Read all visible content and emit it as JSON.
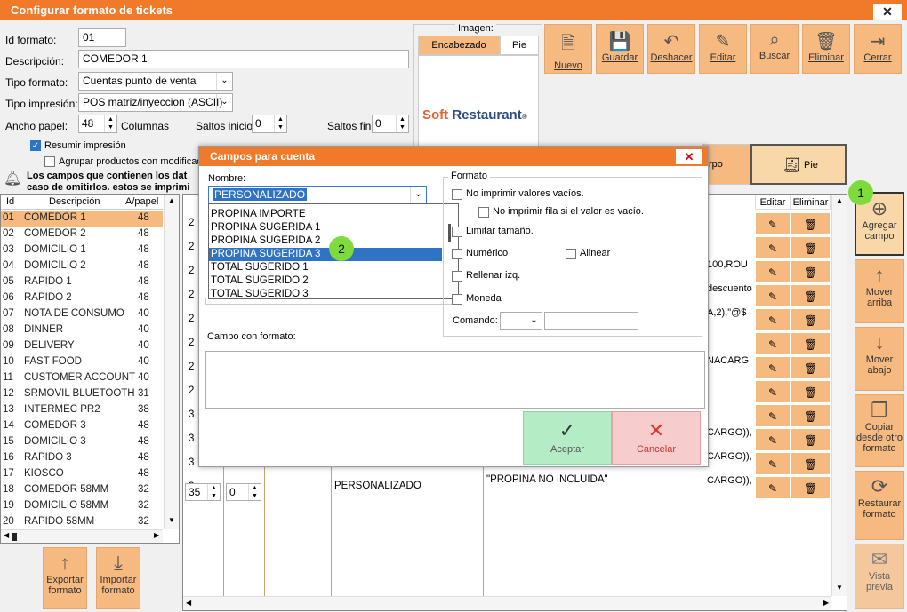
{
  "window": {
    "title": "Configurar formato de tickets",
    "close": "✕"
  },
  "form": {
    "id_label": "Id formato:",
    "id_value": "01",
    "desc_label": "Descripción:",
    "desc_value": "COMEDOR 1",
    "tipo_formato_label": "Tipo formato:",
    "tipo_formato_value": "Cuentas punto de venta",
    "tipo_impresion_label": "Tipo impresión:",
    "tipo_impresion_value": "POS matriz/inyeccion (ASCII)",
    "ancho_label": "Ancho papel:",
    "ancho_value": "48",
    "columnas_label": "Columnas",
    "saltos_inicio_label": "Saltos inicio:",
    "saltos_inicio_value": "0",
    "saltos_fin_label": "Saltos fin:",
    "saltos_fin_value": "0",
    "resumir_label": "Resumir impresión",
    "agrupar_label": "Agrupar productos con modificad",
    "notice_line1": "Los campos que contienen los dat",
    "notice_line2": "caso de omitirlos. estos se imprimi"
  },
  "image_panel": {
    "label": "Imagen:",
    "tab_header": "Encabezado",
    "tab_footer": "Pie",
    "logo_soft": "Soft",
    "logo_restaurant": "Restaurant",
    "logo_reg": "®"
  },
  "toolbar": [
    {
      "label": "Nuevo",
      "icon": "new-icon"
    },
    {
      "label": "Guardar",
      "icon": "save-icon"
    },
    {
      "label": "Deshacer",
      "icon": "undo-icon"
    },
    {
      "label": "Editar",
      "icon": "edit-icon"
    },
    {
      "label": "Buscar",
      "icon": "search-icon"
    },
    {
      "label": "Eliminar",
      "icon": "delete-icon"
    },
    {
      "label": "Cerrar",
      "icon": "exit-icon"
    }
  ],
  "section_tabs": {
    "cuerpo": "rpo",
    "pie": "Pie"
  },
  "formats_table": {
    "headers": [
      "Id",
      "Descripción",
      "A/papel"
    ],
    "rows": [
      [
        "01",
        "COMEDOR 1",
        "48"
      ],
      [
        "02",
        "COMEDOR 2",
        "48"
      ],
      [
        "03",
        "DOMICILIO 1",
        "48"
      ],
      [
        "04",
        "DOMICILIO 2",
        "48"
      ],
      [
        "05",
        "RAPIDO 1",
        "48"
      ],
      [
        "06",
        "RAPIDO 2",
        "48"
      ],
      [
        "07",
        "NOTA DE CONSUMO",
        "40"
      ],
      [
        "08",
        "DINNER",
        "40"
      ],
      [
        "09",
        "DELIVERY",
        "40"
      ],
      [
        "10",
        "FAST FOOD",
        "40"
      ],
      [
        "11",
        "CUSTOMER ACCOUNT",
        "40"
      ],
      [
        "12",
        "SRMOVIL BLUETOOTH",
        "31"
      ],
      [
        "13",
        "INTERMEC PR2",
        "38"
      ],
      [
        "14",
        "COMEDOR 3",
        "48"
      ],
      [
        "15",
        "DOMICILIO 3",
        "48"
      ],
      [
        "16",
        "RAPIDO 3",
        "48"
      ],
      [
        "17",
        "KIOSCO",
        "48"
      ],
      [
        "18",
        "COMEDOR 58MM",
        "32"
      ],
      [
        "19",
        "DOMICILIO 58MM",
        "32"
      ],
      [
        "20",
        "RAPIDO 58MM",
        "32"
      ]
    ]
  },
  "fields_grid": {
    "headers": {
      "editar": "Editar",
      "eliminar": "Eliminar"
    },
    "left_values": [
      "2",
      "2",
      "2",
      "2",
      "2",
      "2",
      "2",
      "2",
      "3",
      "3",
      "3",
      "3"
    ],
    "right_texts": [
      "",
      "100,ROU",
      "descuento",
      "A,2),\"@$",
      "",
      "NACARG",
      "",
      "",
      "CARGO)),",
      "CARGO)),",
      "CARGO)),",
      ""
    ],
    "last_row": {
      "pos": "35",
      "val": "0",
      "name": "PERSONALIZADO",
      "text": "\"PROPINA NO INCLUIDA\""
    }
  },
  "side_buttons": [
    {
      "label": "Agregar campo",
      "icon": "add-circle-icon"
    },
    {
      "label": "Mover arriba",
      "icon": "arrow-up-icon"
    },
    {
      "label": "Mover abajo",
      "icon": "arrow-down-icon"
    },
    {
      "label": "Copiar desde otro formato",
      "icon": "copy-icon"
    },
    {
      "label": "Restaurar formato",
      "icon": "restore-icon"
    },
    {
      "label": "Vista previa",
      "icon": "preview-icon"
    }
  ],
  "bottom_buttons": [
    {
      "label": "Exportar formato"
    },
    {
      "label": "Importar formato"
    }
  ],
  "dialog": {
    "title": "Campos para cuenta",
    "nombre_label": "Nombre:",
    "nombre_value": "PERSONALIZADO",
    "dropdown_options": [
      "PROPINA IMPORTE",
      "PROPINA SUGERIDA 1",
      "PROPINA SUGERIDA 2",
      "PROPINA SUGERIDA 3",
      "TOTAL SUGERIDO 1",
      "TOTAL SUGERIDO 2",
      "TOTAL SUGERIDO 3"
    ],
    "selected_index": 3,
    "formato_label": "Formato",
    "no_imprimir_vacios": "No imprimir valores vacíos.",
    "no_imprimir_fila": "No imprimir fila si el valor es vacío.",
    "limitar": "Limitar tamaño.",
    "numerico": "Numérico",
    "alinear": "Alinear",
    "rellenar": "Rellenar izq.",
    "moneda": "Moneda",
    "comando_label": "Comando:",
    "campo_formato_label": "Campo con formato:",
    "aceptar": "Aceptar",
    "cancelar": "Cancelar"
  },
  "callouts": {
    "one": "1",
    "two": "2"
  }
}
